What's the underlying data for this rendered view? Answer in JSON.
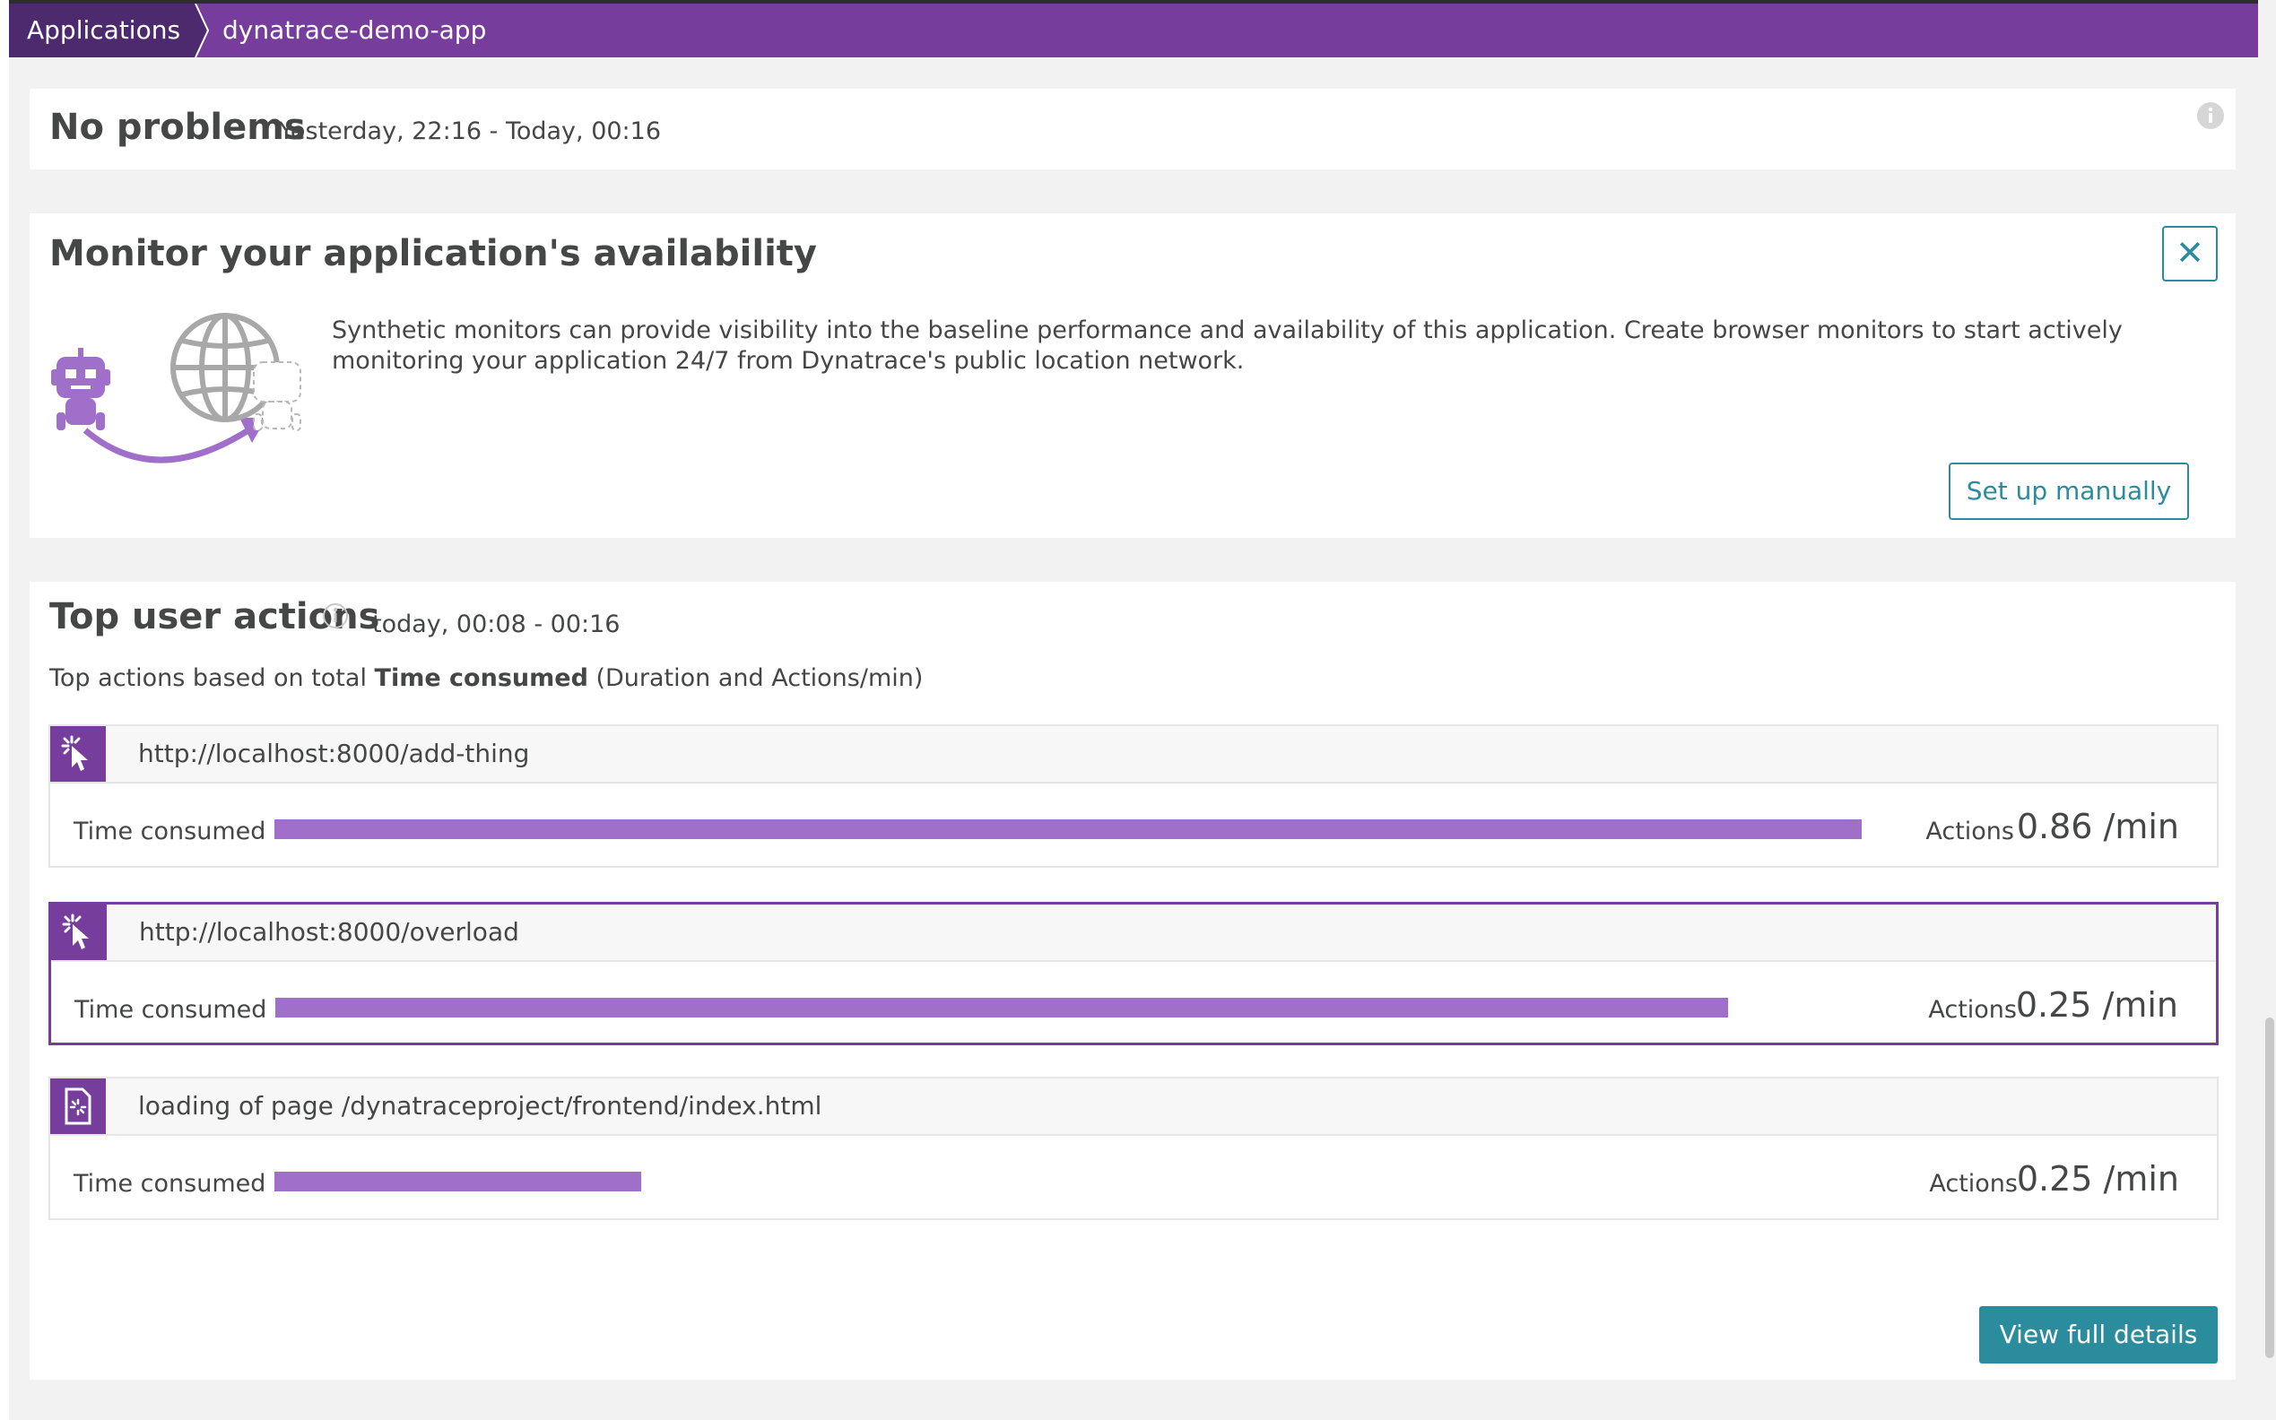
{
  "breadcrumb": {
    "root": "Applications",
    "current": "dynatrace-demo-app"
  },
  "problems": {
    "title": "No problems",
    "timeframe": "Yesterday, 22:16 - Today, 00:16"
  },
  "monitor": {
    "title": "Monitor your application's availability",
    "description": "Synthetic monitors can provide visibility into the baseline performance and availability of this application. Create browser monitors to start actively monitoring your application 24/7 from Dynatrace's public location network.",
    "setup_label": "Set up manually",
    "close_label": "✕"
  },
  "top_actions": {
    "title": "Top user actions",
    "timeframe": "today, 00:08 - 00:16",
    "subtitle_prefix": "Top actions based on total ",
    "subtitle_bold": "Time consumed",
    "subtitle_suffix": " (Duration and Actions/min)",
    "time_consumed_label": "Time consumed",
    "actions_label": "Actions",
    "items": [
      {
        "name": "http://localhost:8000/add-thing",
        "type": "click",
        "actions_per_min": "0.86 /min",
        "time_consumed_fraction": 1.0
      },
      {
        "name": "http://localhost:8000/overload",
        "type": "click",
        "actions_per_min": "0.25 /min",
        "time_consumed_fraction": 0.915
      },
      {
        "name": "loading of page /dynatraceproject/frontend/index.html",
        "type": "page-load",
        "actions_per_min": "0.25 /min",
        "time_consumed_fraction": 0.231
      }
    ],
    "selected_index": 1,
    "view_details_label": "View full details"
  },
  "colors": {
    "brand_purple": "#763d9d",
    "bar_purple": "#a06fc9",
    "teal": "#2a8c9d"
  }
}
